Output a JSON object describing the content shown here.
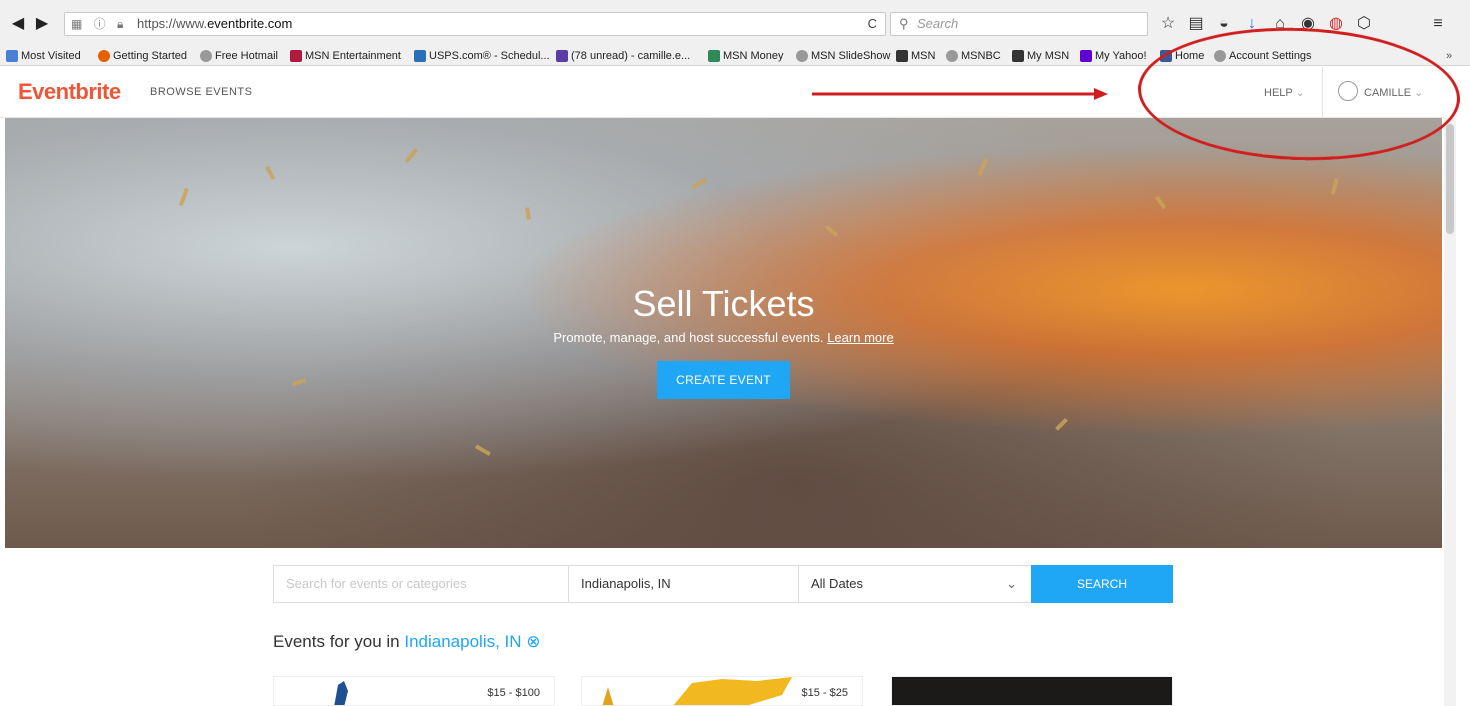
{
  "browser": {
    "url_prefix": "https://www.",
    "url_domain": "eventbrite.com",
    "search_placeholder": "Search",
    "bookmarks": [
      {
        "label": "Most Visited",
        "color": "#4a7fd6"
      },
      {
        "label": "Getting Started",
        "color": "#e66000"
      },
      {
        "label": "Free Hotmail",
        "color": "#888888"
      },
      {
        "label": "MSN Entertainment",
        "color": "#b0193d"
      },
      {
        "label": "USPS.com® - Schedul...",
        "color": "#2a6fb7"
      },
      {
        "label": "(78 unread) - camille.e...",
        "color": "#5a3ea8"
      },
      {
        "label": "MSN Money",
        "color": "#2e8b57"
      },
      {
        "label": "MSN SlideShow",
        "color": "#888888"
      },
      {
        "label": "MSN",
        "color": "#333333"
      },
      {
        "label": "MSNBC",
        "color": "#888888"
      },
      {
        "label": "My MSN",
        "color": "#333333"
      },
      {
        "label": "My Yahoo!",
        "color": "#5f01d1"
      },
      {
        "label": "Home",
        "color": "#3b5998"
      },
      {
        "label": "Account Settings",
        "color": "#888888"
      }
    ]
  },
  "header": {
    "logo": "Eventbrite",
    "browse": "BROWSE EVENTS",
    "help": "HELP",
    "user": "CAMILLE"
  },
  "hero": {
    "title": "Sell Tickets",
    "subtitle": "Promote, manage, and host successful events.",
    "learn_more": "Learn more",
    "cta": "CREATE EVENT"
  },
  "search": {
    "placeholder": "Search for events or categories",
    "location": "Indianapolis, IN",
    "date": "All Dates",
    "button": "SEARCH"
  },
  "events": {
    "heading": "Events for you in",
    "city": "Indianapolis, IN",
    "cards": [
      {
        "price": "$15 - $100"
      },
      {
        "price": "$15 - $25"
      },
      {
        "price": ""
      }
    ]
  },
  "annotation": {
    "color": "#d01e1e"
  }
}
